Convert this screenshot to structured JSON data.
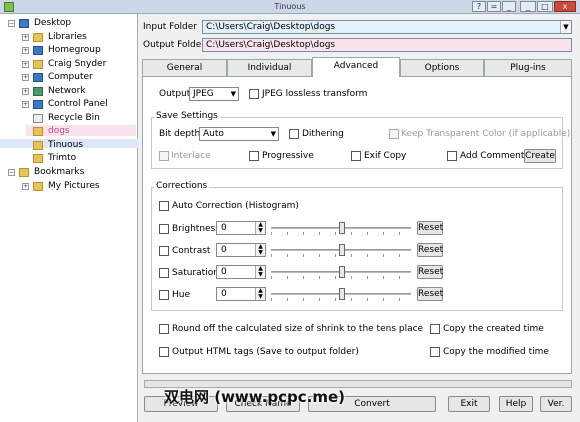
{
  "window": {
    "title": "Tinuous",
    "buttons": [
      "?",
      "=",
      "_",
      "□",
      "x"
    ]
  },
  "tree": [
    {
      "label": "Desktop",
      "icon": "desktop-icon"
    },
    {
      "label": "Libraries",
      "icon": "folder-icon"
    },
    {
      "label": "Homegroup",
      "icon": "homegroup-icon"
    },
    {
      "label": "Craig Snyder",
      "icon": "user-folder-icon"
    },
    {
      "label": "Computer",
      "icon": "computer-icon"
    },
    {
      "label": "Network",
      "icon": "network-icon"
    },
    {
      "label": "Control Panel",
      "icon": "control-panel-icon"
    },
    {
      "label": "Recycle Bin",
      "icon": "recycle-bin-icon"
    },
    {
      "label": "dogs",
      "icon": "folder-icon"
    },
    {
      "label": "Tinuous",
      "icon": "folder-icon"
    },
    {
      "label": "Trimto",
      "icon": "folder-icon"
    },
    {
      "label": "Bookmarks",
      "icon": "bookmark-icon"
    },
    {
      "label": "My Pictures",
      "icon": "folder-icon"
    }
  ],
  "paths": {
    "input_label": "Input Folder",
    "input_value": "C:\\Users\\Craig\\Desktop\\dogs",
    "output_label": "Output Folder",
    "output_value": "C:\\Users\\Craig\\Desktop\\dogs"
  },
  "tabs": [
    "General",
    "Individual",
    "Advanced",
    "Options",
    "Plug-ins"
  ],
  "output": {
    "label": "Output",
    "format": "JPEG",
    "lossless_label": "JPEG lossless transform"
  },
  "save_settings": {
    "title": "Save Settings",
    "bitdepth_label": "Bit depth",
    "bitdepth_value": "Auto",
    "dithering": "Dithering",
    "keep_transparent": "Keep Transparent Color (if applicable)",
    "interlace": "Interlace",
    "progressive": "Progressive",
    "exif_copy": "Exif Copy",
    "add_comment": "Add Comment",
    "create_button": "Create"
  },
  "corrections": {
    "title": "Corrections",
    "auto": "Auto Correction (Histogram)",
    "rows": [
      {
        "label": "Brightness",
        "value": "0"
      },
      {
        "label": "Contrast",
        "value": "0"
      },
      {
        "label": "Saturation",
        "value": "0"
      },
      {
        "label": "Hue",
        "value": "0"
      }
    ],
    "reset_label": "Reset"
  },
  "options": {
    "round_off": "Round off the calculated size of shrink to the tens place",
    "copy_created": "Copy the created time",
    "output_html": "Output HTML tags (Save to output folder)",
    "copy_modified": "Copy the modified time"
  },
  "bottom": {
    "preview": "Preview",
    "check_name": "Check Name",
    "convert": "Convert",
    "exit": "Exit",
    "help": "Help",
    "ver": "Ver."
  },
  "watermark": "双电网 (www.pcpc.me)"
}
